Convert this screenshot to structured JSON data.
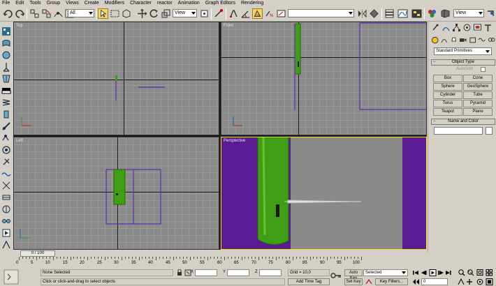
{
  "menu": [
    "File",
    "Edit",
    "Tools",
    "Group",
    "Views",
    "Create",
    "Modifiers",
    "Character",
    "reactor",
    "Animation",
    "Graph Editors",
    "Rendering"
  ],
  "toolbar": {
    "selection_filter": "All",
    "ref_coord": "View",
    "named_selection": "View"
  },
  "viewports": {
    "top": "Top",
    "front": "Front",
    "left": "Left",
    "perspective": "Perspective"
  },
  "command_panel": {
    "category_dropdown": "Standard Primitives",
    "object_type_header": "Object Type",
    "autogrid_label": "AutoGrid",
    "buttons": [
      "Box",
      "Cone",
      "Sphere",
      "GeoSphere",
      "Cylinder",
      "Tube",
      "Torus",
      "Pyramid",
      "Teapot",
      "Plane"
    ],
    "name_color_header": "Name and Color",
    "name_value": ""
  },
  "timeline": {
    "slider_label": "0 / 100",
    "ticks": [
      "0",
      "5",
      "10",
      "15",
      "20",
      "25",
      "30",
      "35",
      "40",
      "45",
      "50",
      "55",
      "60",
      "65",
      "70",
      "75",
      "80",
      "85",
      "90",
      "95",
      "100"
    ]
  },
  "status": {
    "selection": "None Selected",
    "prompt": "Click or click-and-drag to select objects",
    "x_label": "X",
    "y_label": "Y",
    "z_label": "Z",
    "grid": "Grid = 10,0",
    "add_time_tag": "Add Time Tag",
    "auto_key": "Auto Key",
    "auto_key_mode": "Selected",
    "set_key": "Set Key",
    "key_filters": "Key Filters...",
    "frame": "0"
  },
  "colors": {
    "perspective_bg": "#5a1c94",
    "viewport_gray": "#8a8a8a",
    "active_border": "#f2e400",
    "object_green": "#3f9e14"
  }
}
